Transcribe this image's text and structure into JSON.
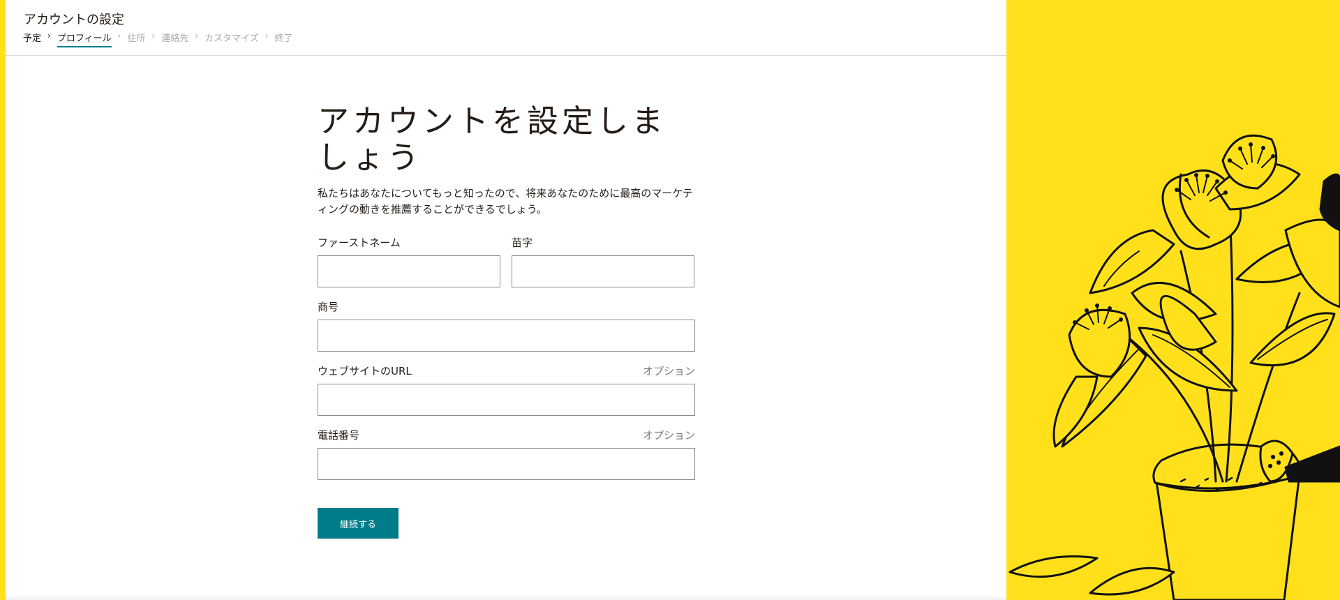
{
  "header": {
    "app_title": "アカウントの設定",
    "breadcrumb": [
      {
        "label": "予定",
        "state": "done"
      },
      {
        "label": "プロフィール",
        "state": "active"
      },
      {
        "label": "住所",
        "state": "pending"
      },
      {
        "label": "連絡先",
        "state": "pending"
      },
      {
        "label": "カスタマイズ",
        "state": "pending"
      },
      {
        "label": "終了",
        "state": "pending"
      }
    ]
  },
  "form": {
    "heading": "アカウントを設定しましょう",
    "lead": "私たちはあなたについてもっと知ったので、将来あなたのために最高のマーケティングの動きを推薦することができるでしょう。",
    "fields": {
      "first_name": {
        "label": "ファーストネーム",
        "value": ""
      },
      "last_name": {
        "label": "苗字",
        "value": ""
      },
      "business_name": {
        "label": "商号",
        "value": ""
      },
      "website": {
        "label": "ウェブサイトのURL",
        "optional": "オプション",
        "value": ""
      },
      "phone": {
        "label": "電話番号",
        "optional": "オプション",
        "value": ""
      }
    },
    "submit_label": "継続する"
  },
  "illustration": {
    "icon": "potted-plant-illustration"
  },
  "colors": {
    "accent_yellow": "#ffe01b",
    "primary_teal": "#007c89",
    "text": "#241c15",
    "muted": "#aaaaaa",
    "border": "#8a8a8a"
  }
}
